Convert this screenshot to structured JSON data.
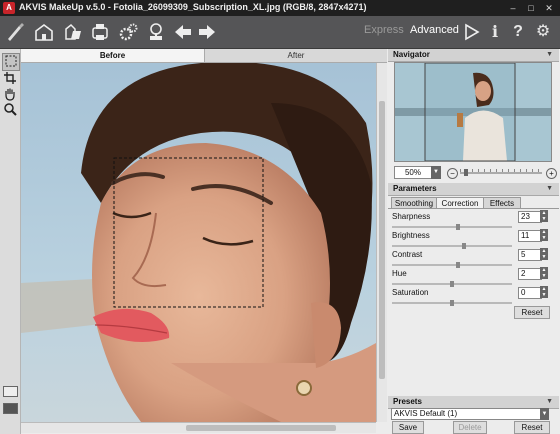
{
  "window": {
    "app_icon": "A",
    "title": "AKVIS MakeUp v.5.0 - Fotolia_26099309_Subscription_XL.jpg (RGB/8, 2847x4271)",
    "minimize": "–",
    "maximize": "□",
    "close": "✕"
  },
  "toolbar": {
    "icons": [
      "home-icon",
      "open-file-icon",
      "save-file-icon",
      "print-icon",
      "settings-gear-icon",
      "stamp-icon",
      "back-arrow-icon",
      "forward-arrow-icon"
    ],
    "mode_express": "Express",
    "mode_advanced": "Advanced",
    "run_icon": "▷",
    "info_icon": "i",
    "help_icon": "?",
    "prefs_icon": "⚙"
  },
  "tabs": {
    "before": "Before",
    "after": "After"
  },
  "navigator": {
    "header": "Navigator",
    "zoom": "50%"
  },
  "parameters": {
    "header": "Parameters",
    "tabs": [
      "Smoothing",
      "Correction",
      "Effects"
    ],
    "active_tab": "Correction",
    "items": [
      {
        "label": "Sharpness",
        "value": "23",
        "level": 0.55
      },
      {
        "label": "Brightness",
        "value": "11",
        "level": 0.6
      },
      {
        "label": "Contrast",
        "value": "5",
        "level": 0.55
      },
      {
        "label": "Hue",
        "value": "2",
        "level": 0.5
      },
      {
        "label": "Saturation",
        "value": "0",
        "level": 0.5
      }
    ],
    "reset_label": "Reset"
  },
  "presets": {
    "header": "Presets",
    "selected": "AKVIS Default (1)",
    "save_label": "Save",
    "delete_label": "Delete",
    "reset_label": "Reset"
  }
}
